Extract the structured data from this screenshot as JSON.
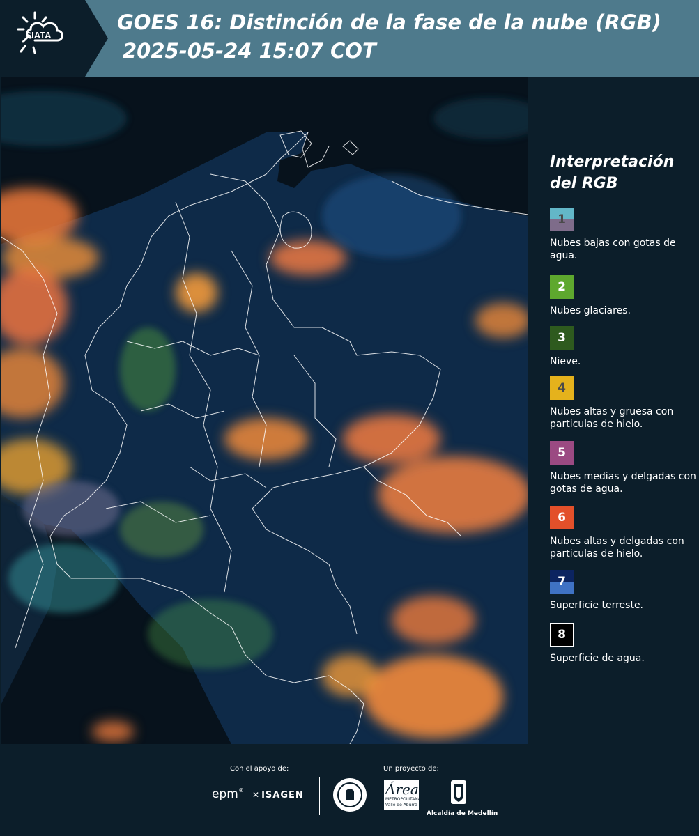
{
  "header": {
    "logo_text": "SIATA",
    "title_line_1": "GOES 16: Distinción de la fase de la nube (RGB)",
    "title_line_2": "2025-05-24 15:07 COT"
  },
  "colors": {
    "header_bg": "#4e7a8c",
    "panel_bg": "#0c1e2a",
    "map_ocean": "#07121c",
    "map_land": "#0e2a48"
  },
  "legend": {
    "title": "Interpretación del RGB",
    "items": [
      {
        "number": "1",
        "label": "Nubes bajas con gotas de agua.",
        "color_top": "#63b7c8",
        "color_bottom": "#7e6c8a",
        "text_color": "#4a4a4a"
      },
      {
        "number": "2",
        "label": "Nubes glaciares.",
        "color_top": "#5ea82e",
        "color_bottom": "#5ea82e",
        "text_color": "#ffffff"
      },
      {
        "number": "3",
        "label": "Nieve.",
        "color_top": "#2e5a1e",
        "color_bottom": "#2e5a1e",
        "text_color": "#ffffff"
      },
      {
        "number": "4",
        "label": "Nubes altas y gruesa con particulas de hielo.",
        "color_top": "#e5b21c",
        "color_bottom": "#e5b21c",
        "text_color": "#4a4a4a"
      },
      {
        "number": "5",
        "label": "Nubes medias y delgadas con gotas de agua.",
        "color_top": "#9b4a82",
        "color_bottom": "#9b4a82",
        "text_color": "#ffffff"
      },
      {
        "number": "6",
        "label": "Nubes altas y delgadas con particulas de hielo.",
        "color_top": "#e3502a",
        "color_bottom": "#e3502a",
        "text_color": "#ffffff"
      },
      {
        "number": "7",
        "label": "Superficie terreste.",
        "color_top": "#0c2460",
        "color_bottom": "#3f72c4",
        "text_color": "#ffffff"
      },
      {
        "number": "8",
        "label": "Superficie de agua.",
        "color_top": "#000000",
        "color_bottom": "#000000",
        "text_color": "#ffffff"
      }
    ]
  },
  "footer": {
    "support_caption": "Con el apoyo de:",
    "project_caption": "Un proyecto de:",
    "sponsors": {
      "epm": "epm",
      "isagen": "ISAGEN",
      "area_big": "Área",
      "area_small_1": "METROPOLITANA",
      "area_small_2": "Valle de Aburrá",
      "alcaldia": "Alcaldía de Medellín"
    }
  }
}
